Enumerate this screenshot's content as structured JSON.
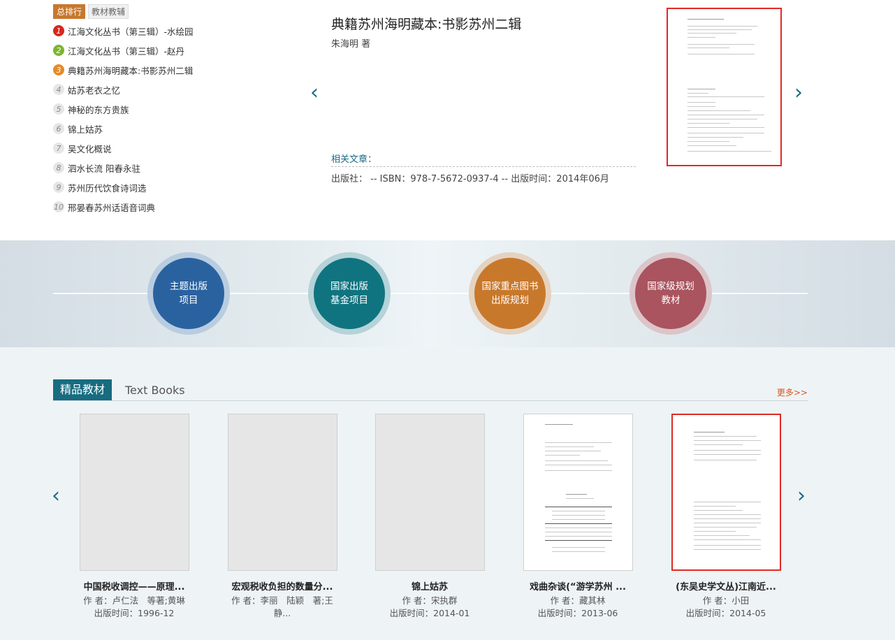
{
  "ranking": {
    "tabs": [
      {
        "label": "总排行",
        "active": true
      },
      {
        "label": "教材教辅",
        "active": false
      }
    ],
    "items": [
      {
        "num": "1",
        "title": "江海文化丛书（第三辑）-水绘园"
      },
      {
        "num": "2",
        "title": "江海文化丛书（第三辑）-赵丹"
      },
      {
        "num": "3",
        "title": "典籍苏州海明藏本:书影苏州二辑"
      },
      {
        "num": "4",
        "title": "姑苏老衣之忆"
      },
      {
        "num": "5",
        "title": "神秘的东方贵族"
      },
      {
        "num": "6",
        "title": "锦上姑苏"
      },
      {
        "num": "7",
        "title": "吴文化概说"
      },
      {
        "num": "8",
        "title": "泗水长流 阳春永驻"
      },
      {
        "num": "9",
        "title": "苏州历代饮食诗词选"
      },
      {
        "num": "10",
        "title": "邢晏春苏州话语音词典"
      }
    ]
  },
  "featured": {
    "title": "典籍苏州海明藏本:书影苏州二辑",
    "author": "朱海明 著",
    "related_label": "相关文章：",
    "pub_info": "出版社： -- ISBN：978-7-5672-0937-4 -- 出版时间：2014年06月",
    "prev_icon": "chevron-left-icon",
    "next_icon": "chevron-right-icon"
  },
  "banner": {
    "items": [
      {
        "label": "主题出版\n项目",
        "color": "#2a62a0",
        "ring": "#b9cde0"
      },
      {
        "label": "国家出版\n基金项目",
        "color": "#0f7480",
        "ring": "#b5d3d8"
      },
      {
        "label": "国家重点图书\n出版规划",
        "color": "#c8782b",
        "ring": "#e4d3c0"
      },
      {
        "label": "国家级规划\n教材",
        "color": "#a9545e",
        "ring": "#dcc5c9"
      }
    ]
  },
  "textbooks": {
    "title_cn": "精品教材",
    "title_en": "Text Books",
    "more": "更多>>",
    "books": [
      {
        "title": "中国税收调控——原理...",
        "author": "作 者：卢仁法　等著;黄琳",
        "date": "出版时间：1996-12"
      },
      {
        "title": "宏观税收负担的数量分...",
        "author": "作 者：李丽　陆颖　著;王静...",
        "date": ""
      },
      {
        "title": "锦上姑苏",
        "author": "作 者：宋执群",
        "date": "出版时间：2014-01"
      },
      {
        "title": "戏曲杂谈(“游学苏州 ...",
        "author": "作 者：藏其林",
        "date": "出版时间：2013-06"
      },
      {
        "title": "(东吴史学文丛)江南近...",
        "author": "作 者：小田",
        "date": "出版时间：2014-05"
      }
    ]
  }
}
